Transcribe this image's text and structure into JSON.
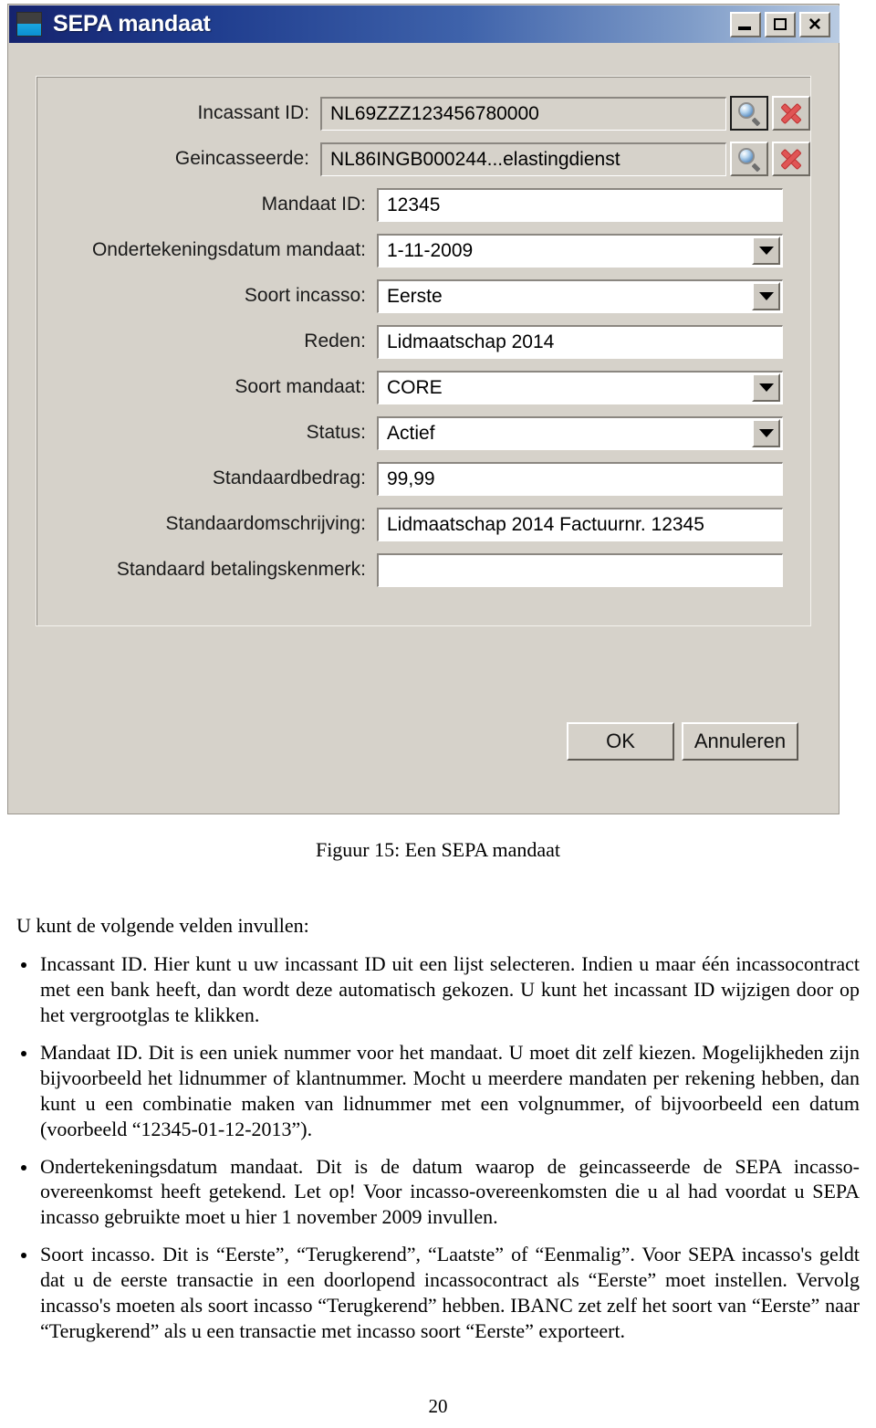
{
  "window": {
    "title": "SEPA mandaat",
    "icon": "app-icon",
    "controls": [
      {
        "name": "minimize-button",
        "glyph": "_"
      },
      {
        "name": "maximize-button",
        "glyph": "□"
      },
      {
        "name": "close-button",
        "glyph": "✕"
      }
    ]
  },
  "form": {
    "fields": [
      {
        "label": "Incassant ID:",
        "value": "NL69ZZZ123456780000",
        "type": "readonly-lookup",
        "has_search": true,
        "has_clear": true,
        "focused": true
      },
      {
        "label": "Geincasseerde:",
        "value": "NL86INGB000244...elastingdienst",
        "type": "readonly-lookup",
        "has_search": true,
        "has_clear": true,
        "focused": false
      },
      {
        "label": "Mandaat ID:",
        "value": "12345",
        "type": "text"
      },
      {
        "label": "Ondertekeningsdatum mandaat:",
        "value": "1-11-2009",
        "type": "combo"
      },
      {
        "label": "Soort incasso:",
        "value": "Eerste",
        "type": "combo"
      },
      {
        "label": "Reden:",
        "value": "Lidmaatschap 2014",
        "type": "text"
      },
      {
        "label": "Soort mandaat:",
        "value": "CORE",
        "type": "combo"
      },
      {
        "label": "Status:",
        "value": "Actief",
        "type": "combo"
      },
      {
        "label": "Standaardbedrag:",
        "value": "99,99",
        "type": "text"
      },
      {
        "label": "Standaardomschrijving:",
        "value": "Lidmaatschap 2014 Factuurnr. 12345",
        "type": "text"
      },
      {
        "label": "Standaard betalingskenmerk:",
        "value": "",
        "type": "text"
      }
    ]
  },
  "buttons": {
    "ok": "OK",
    "cancel": "Annuleren"
  },
  "document": {
    "caption": "Figuur 15: Een SEPA mandaat",
    "intro": "U kunt de volgende velden invullen:",
    "bullets": [
      "Incassant ID. Hier kunt u uw incassant ID uit een lijst selecteren.  Indien u maar één incassocontract met een bank heeft, dan wordt deze automatisch gekozen.  U kunt het incassant ID wijzigen door op het vergrootglas te klikken.",
      "Mandaat ID. Dit is een uniek nummer voor het mandaat. U moet dit zelf kiezen. Mogelijkheden zijn bijvoorbeeld het lidnummer of klantnummer.  Mocht u meerdere mandaten per rekening hebben, dan kunt u een combinatie maken van lidnummer met een volgnummer, of bijvoorbeeld een datum (voorbeeld “12345-01-12-2013”).",
      "Ondertekeningsdatum mandaat. Dit is de datum waarop de geincasseerde de SEPA incasso-overeenkomst heeft getekend. Let op! Voor incasso-overeenkomsten die u al had voordat u SEPA incasso gebruikte moet u hier 1 november 2009 invullen.",
      "Soort incasso. Dit is “Eerste”, “Terugkerend”, “Laatste” of “Eenmalig”. Voor SEPA incasso's geldt dat u de eerste transactie in een doorlopend incassocontract als “Eerste” moet instellen. Vervolg incasso's moeten als soort incasso “Terugkerend” hebben. IBANC zet zelf het soort van “Eerste” naar “Terugkerend” als u een transactie met incasso soort “Eerste” exporteert."
    ],
    "page_number": "20"
  },
  "colors": {
    "title_start": "#16246e",
    "title_end": "#b9cbe2",
    "dialog_bg": "#d6d2ca",
    "clear_icon": "#e05555"
  }
}
